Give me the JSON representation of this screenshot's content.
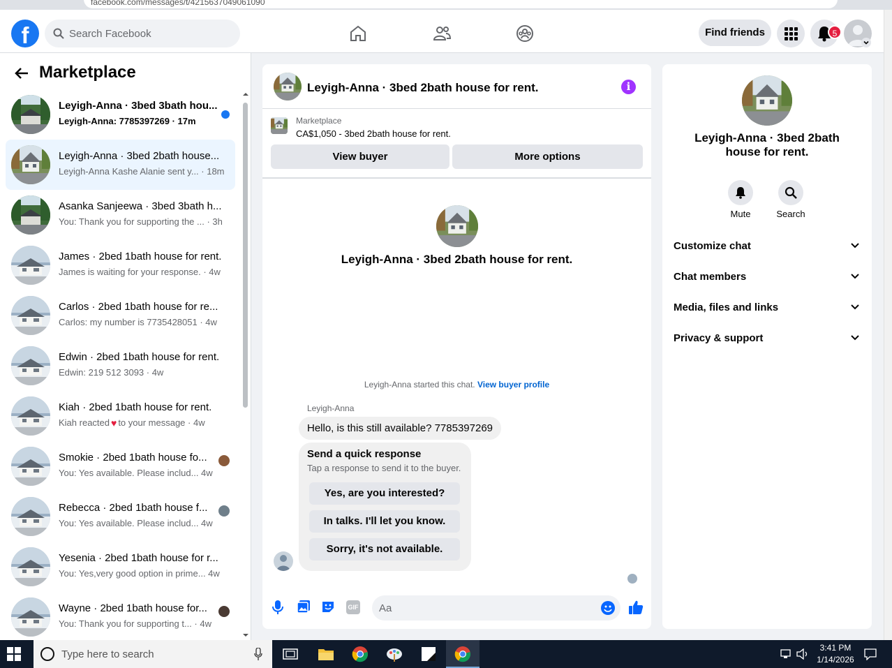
{
  "browser": {
    "url": "facebook.com/messages/t/4215637049061090"
  },
  "header": {
    "logo": "f",
    "search_placeholder": "Search Facebook",
    "find_friends": "Find friends",
    "notifications_count": "5"
  },
  "sidebar": {
    "title": "Marketplace",
    "conversations": [
      {
        "title": "Leyigh-Anna · 3bed 3bath hou...",
        "preview": "Leyigh-Anna: 7785397269 · 17m",
        "unread": true
      },
      {
        "title": "Leyigh-Anna · 3bed 2bath house...",
        "preview": "Leyigh-Anna Kashe Alanie sent y...  · 18m",
        "active": true
      },
      {
        "title": "Asanka Sanjeewa · 3bed 3bath h...",
        "preview": "You: Thank you for supporting the ...  · 3h"
      },
      {
        "title": "James · 2bed 1bath house for rent.",
        "preview": "James is waiting for your response. · 4w"
      },
      {
        "title": "Carlos · 2bed 1bath house for re...",
        "preview": "Carlos: my number is 7735428051 · 4w"
      },
      {
        "title": "Edwin · 2bed 1bath house for rent.",
        "preview": "Edwin: 219 512 3093 · 4w"
      },
      {
        "title": "Kiah · 2bed 1bath house for rent.",
        "preview_a": "Kiah reacted",
        "preview_b": "to your message · 4w"
      },
      {
        "title": "Smokie · 2bed 1bath house fo...",
        "preview": "You: Yes available. Please includ...  4w"
      },
      {
        "title": "Rebecca · 2bed 1bath house f...",
        "preview": "You: Yes available. Please includ...  4w"
      },
      {
        "title": "Yesenia · 2bed 1bath house for r...",
        "preview": "You: Yes,very good option in prime...  4w"
      },
      {
        "title": "Wayne · 2bed 1bath house for...",
        "preview": "You: Thank you for supporting t... · 4w"
      }
    ]
  },
  "chat": {
    "title": "Leyigh-Anna · 3bed 2bath house for rent.",
    "marketplace_label": "Marketplace",
    "listing": "CA$1,050 - 3bed 2bath house for rent.",
    "view_buyer": "View buyer",
    "more_options": "More options",
    "center_title": "Leyigh-Anna · 3bed 2bath house for rent.",
    "started_text": "Leyigh-Anna started this chat.",
    "view_buyer_profile": "View buyer profile",
    "sender": "Leyigh-Anna",
    "message": "Hello, is this still available? 7785397269",
    "quick_title": "Send a quick response",
    "quick_sub": "Tap a response to send it to the buyer.",
    "quick_responses": [
      "Yes, are you interested?",
      "In talks. I'll let you know.",
      "Sorry, it's not available."
    ],
    "composer_placeholder": "Aa",
    "gif_label": "GIF"
  },
  "details": {
    "title": "Leyigh-Anna · 3bed 2bath house for rent.",
    "mute": "Mute",
    "search": "Search",
    "sections": [
      "Customize chat",
      "Chat members",
      "Media, files and links",
      "Privacy & support"
    ]
  },
  "taskbar": {
    "search_placeholder": "Type here to search",
    "time": "3:41 PM",
    "date": "1/14/2026"
  },
  "colors": {
    "brand": "#1877f2",
    "active_row": "#ebf5ff",
    "info_icon": "#a033ff",
    "badge": "#e41e3f"
  }
}
